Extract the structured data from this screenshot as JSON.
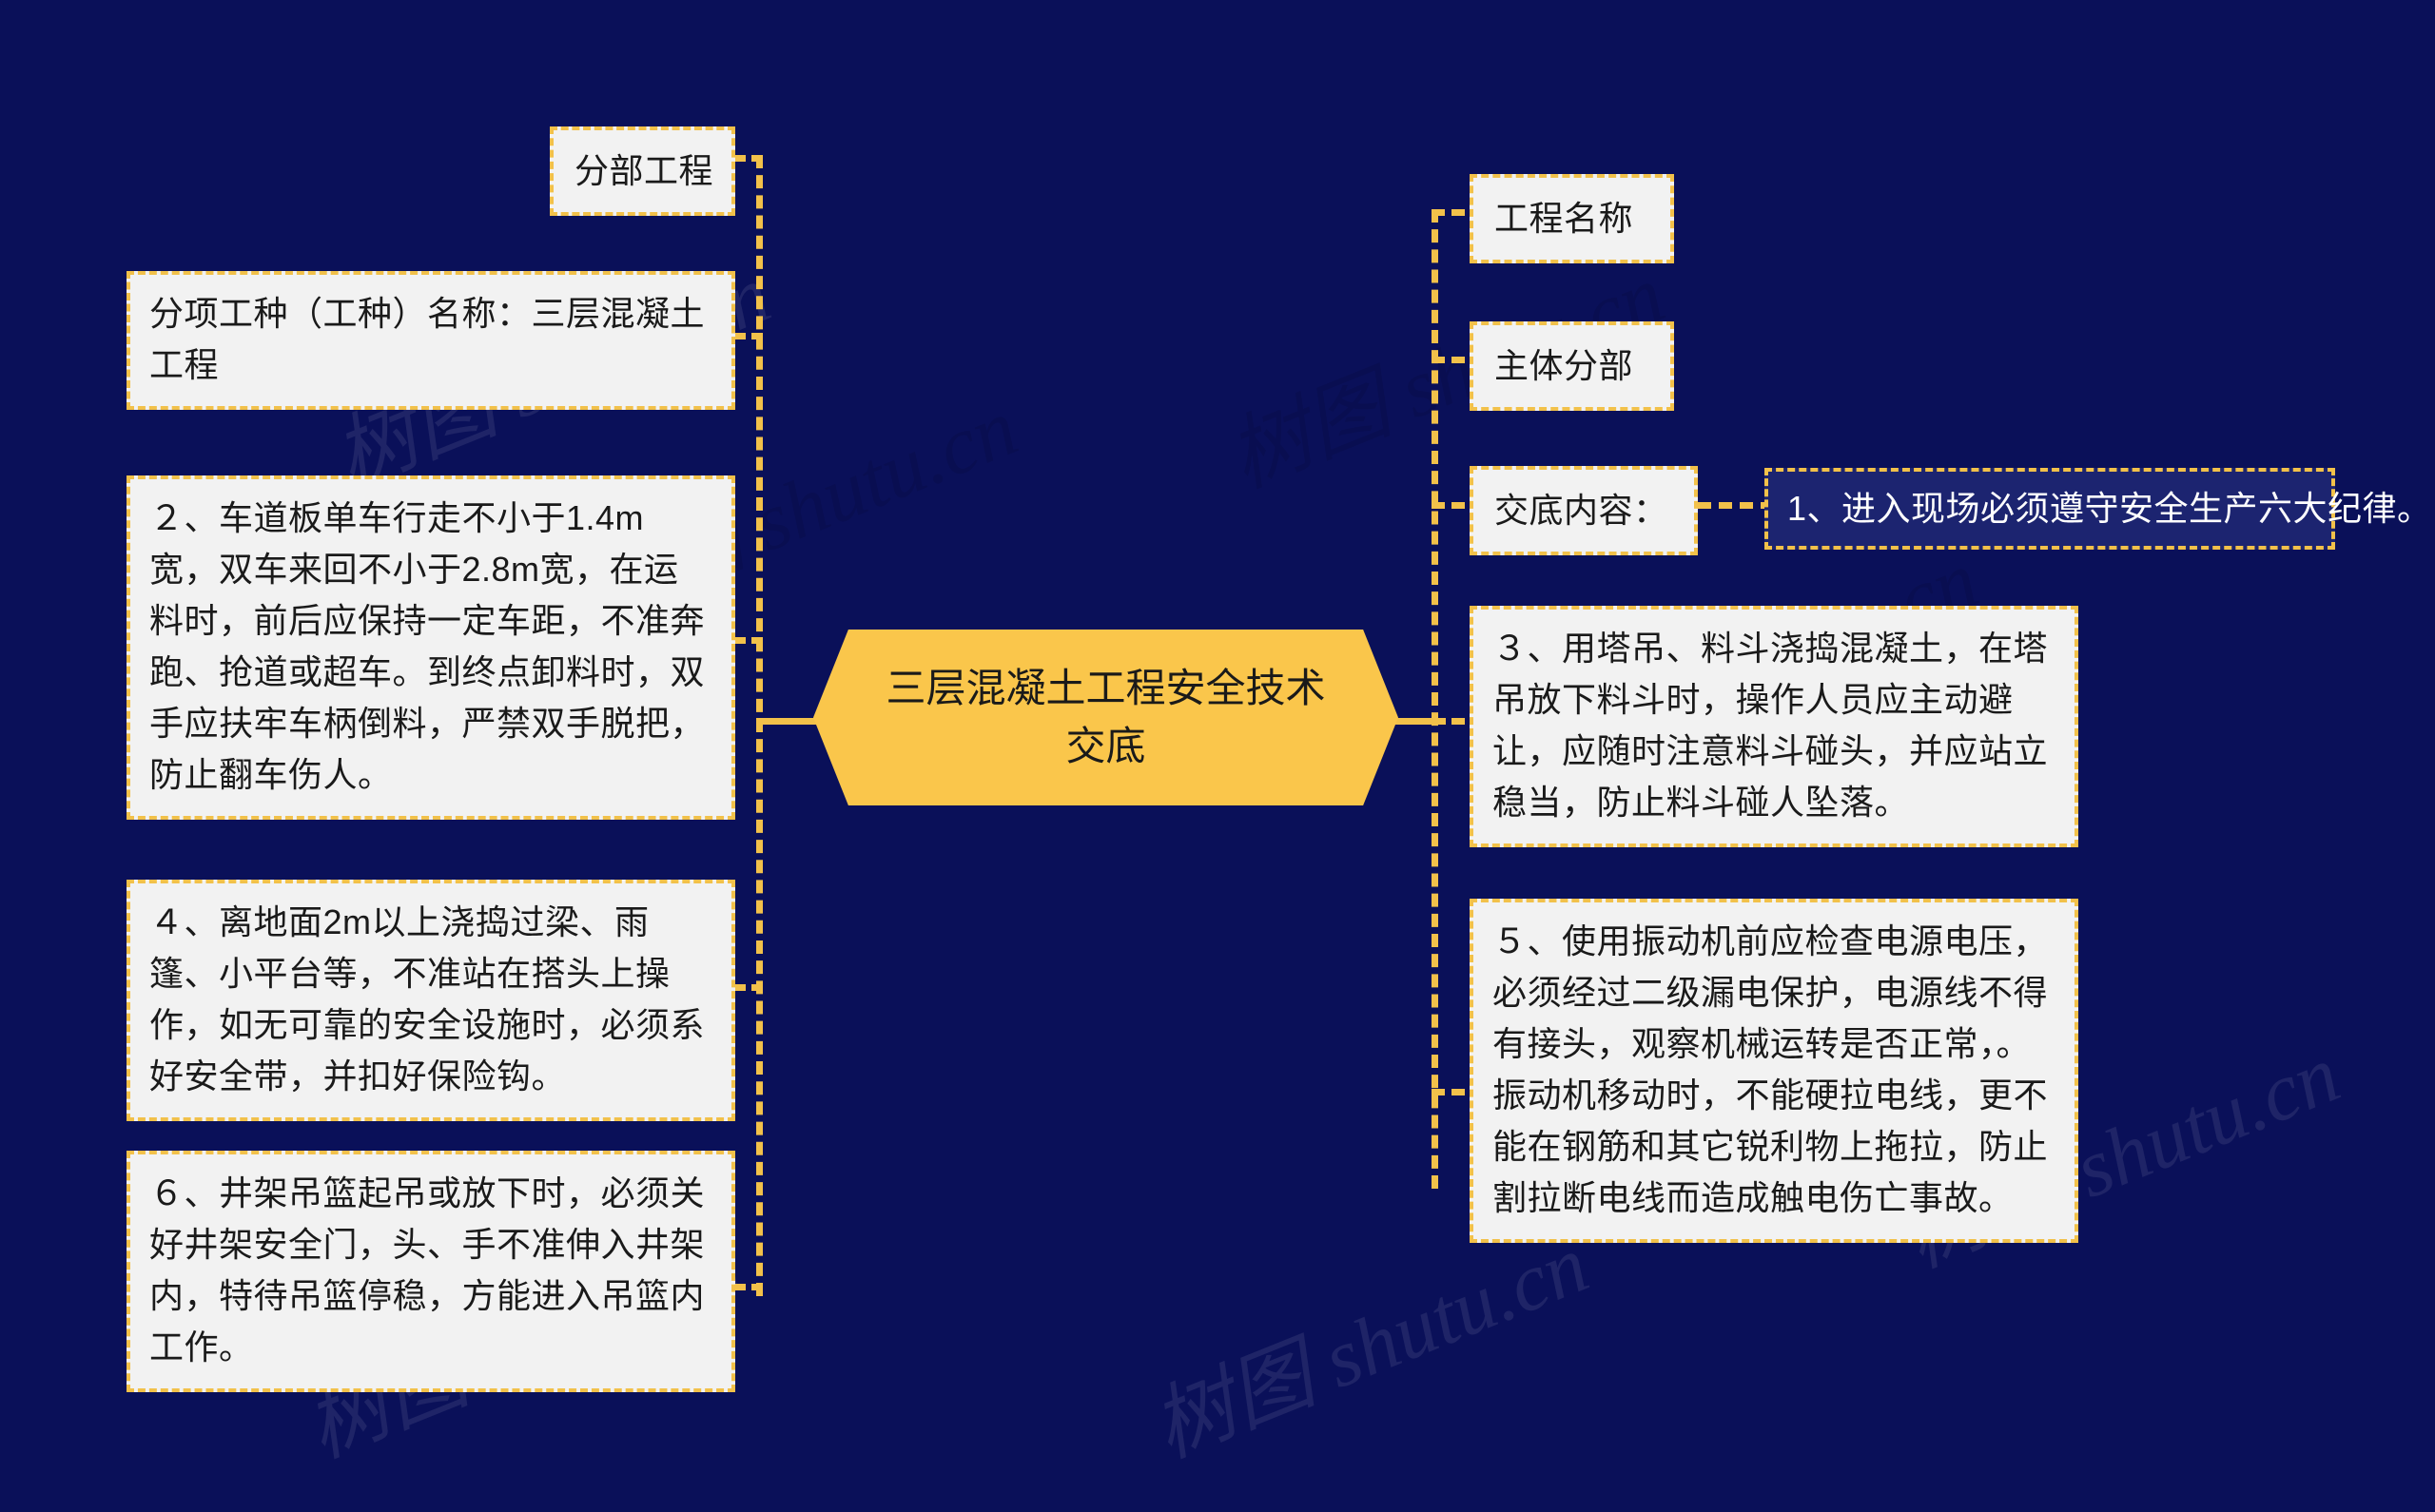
{
  "theme": {
    "background": "#0a1059",
    "accent": "#f2c14a",
    "root_fill": "#fac64b",
    "node_fill": "#f2f2f2",
    "node_text": "#1a1a1a",
    "selected_fill": "#1c2470",
    "selected_text": "#ffffff"
  },
  "watermark": {
    "text": "树图 shutu.cn"
  },
  "root": {
    "label": "三层混凝土工程安全技术交底"
  },
  "left_branch": {
    "nodes": [
      {
        "id": "fenbu-gongcheng",
        "label": "分部工程"
      },
      {
        "id": "fenxiang-gongzhong",
        "label": "分项工种（工种）名称：三层混凝土工程"
      },
      {
        "id": "item-2",
        "label": "２、车道板单车行走不小于1.4m宽，双车来回不小于2.8m宽，在运料时，前后应保持一定车距，不准奔跑、抢道或超车。到终点卸料时，双手应扶牢车柄倒料，严禁双手脱把，防止翻车伤人。"
      },
      {
        "id": "item-4",
        "label": "４、离地面2m以上浇捣过梁、雨篷、小平台等，不准站在搭头上操作，如无可靠的安全设施时，必须系好安全带，并扣好保险钩。"
      },
      {
        "id": "item-6",
        "label": "６、井架吊篮起吊或放下时，必须关好井架安全门，头、手不准伸入井架内，特待吊篮停稳，方能进入吊篮内工作。"
      }
    ]
  },
  "right_branch": {
    "nodes": [
      {
        "id": "gongcheng-mingcheng",
        "label": "工程名称"
      },
      {
        "id": "zhuti-fenbu",
        "label": "主体分部"
      },
      {
        "id": "jiaodi-neirong",
        "label": "交底内容："
      },
      {
        "id": "item-3",
        "label": "３、用塔吊、料斗浇捣混凝土，在塔吊放下料斗时，操作人员应主动避让，应随时注意料斗碰头，并应站立稳当，防止料斗碰人坠落。"
      },
      {
        "id": "item-5",
        "label": "５、使用振动机前应检查电源电压，必须经过二级漏电保护，电源线不得有接头，观察机械运转是否正常，。振动机移动时，不能硬拉电线，更不能在钢筋和其它锐利物上拖拉，防止割拉断电线而造成触电伤亡事故。"
      }
    ]
  },
  "detail_branch": {
    "nodes": [
      {
        "id": "item-1",
        "label": "1、进入现场必须遵守安全生产六大纪律。",
        "selected": true
      }
    ]
  }
}
